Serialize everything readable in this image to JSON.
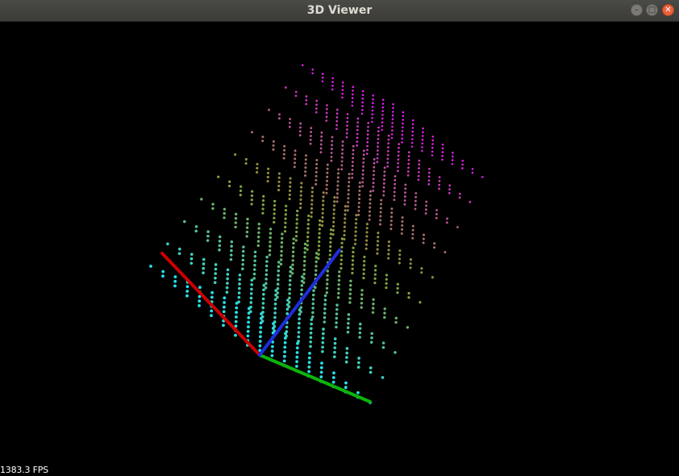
{
  "window": {
    "title": "3D Viewer",
    "buttons": {
      "minimize": "–",
      "maximize": "□",
      "close": "✕"
    }
  },
  "viewport": {
    "fps_text": "1383.3 FPS",
    "background": "#000000",
    "axes": [
      {
        "name": "x-axis",
        "color": "#cc0000"
      },
      {
        "name": "y-axis",
        "color": "#0cb40c"
      },
      {
        "name": "z-axis",
        "color": "#1f2ee0"
      }
    ],
    "point_cloud": {
      "grid_size": 10,
      "color_near": "#28e0e8",
      "color_mid": "#8a9a2a",
      "color_far": "#e01ee8"
    }
  }
}
